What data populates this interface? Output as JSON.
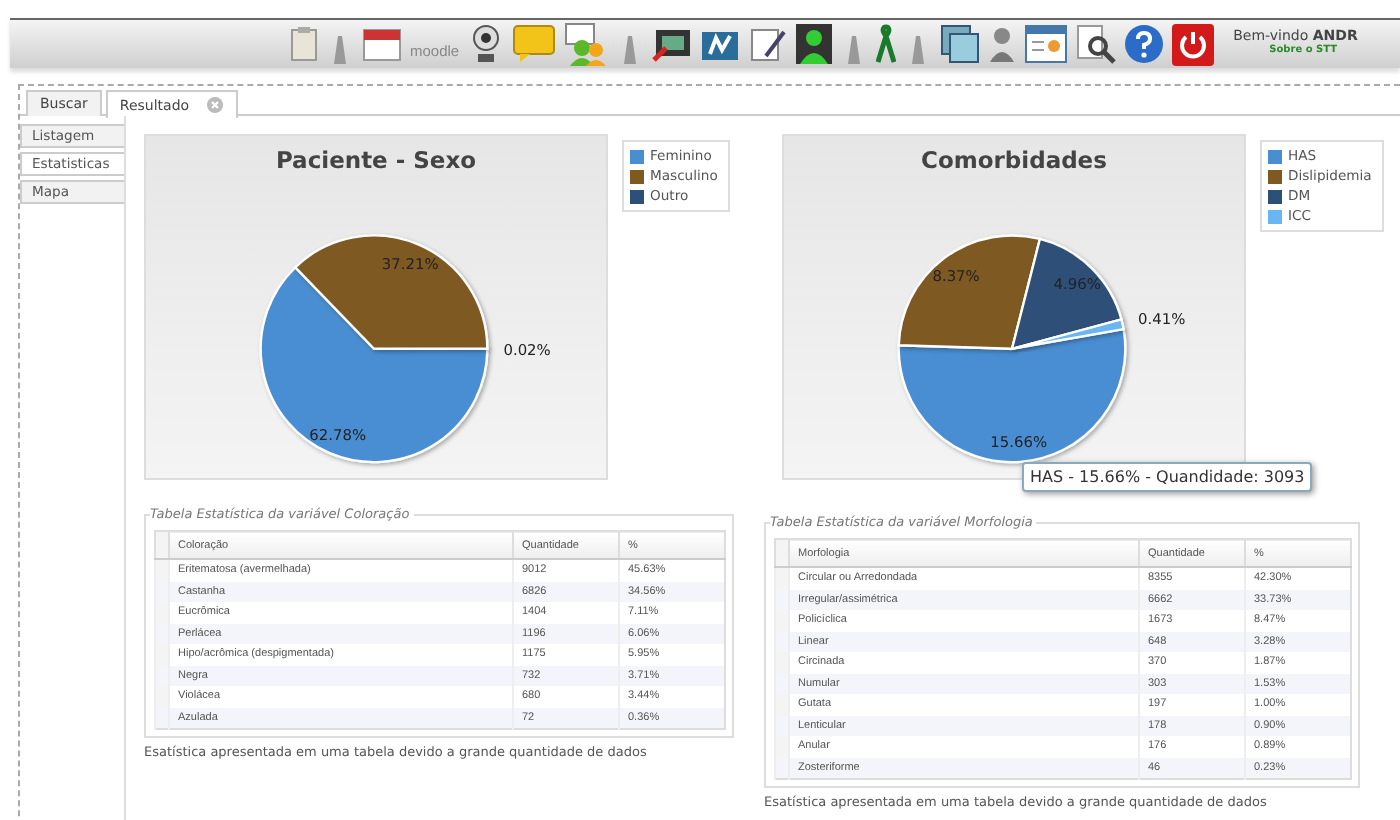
{
  "toolbar": {
    "logo_text": "moodle",
    "welcome": "Bem-vindo",
    "user": "ANDR",
    "about_link": "Sobre o STT"
  },
  "tabs": [
    {
      "label": "Buscar",
      "selected": false,
      "closable": false
    },
    {
      "label": "Resultado",
      "selected": true,
      "closable": true
    }
  ],
  "side_menu": [
    {
      "label": "Listagem",
      "selected": false
    },
    {
      "label": "Estatisticas",
      "selected": true
    },
    {
      "label": "Mapa",
      "selected": false
    }
  ],
  "charts": [
    {
      "chart_data": {
        "type": "pie",
        "title": "Paciente - Sexo",
        "categories": [
          "Feminino",
          "Masculino",
          "Outro"
        ],
        "values": [
          62.78,
          37.21,
          0.02
        ],
        "value_labels": [
          "62.78%",
          "37.21%",
          "0.02%"
        ],
        "colors": [
          "#4a8ed2",
          "#7e5a22",
          "#2d5078"
        ]
      }
    },
    {
      "chart_data": {
        "type": "pie",
        "title": "Comorbidades",
        "categories": [
          "HAS",
          "Dislipidemia",
          "DM",
          "ICC"
        ],
        "values": [
          15.66,
          8.37,
          4.96,
          0.41
        ],
        "value_labels": [
          "15.66%",
          "8.37%",
          "4.96%",
          "0.41%"
        ],
        "colors": [
          "#4a8ed2",
          "#7e5a22",
          "#2d5078",
          "#6ab6f2"
        ]
      },
      "tooltip": "HAS - 15.66% - Quandidade: 3093"
    }
  ],
  "tables": [
    {
      "legend": "Tabela Estatística da variável Coloração",
      "columns": [
        "Coloração",
        "Quantidade",
        "%"
      ],
      "rows": [
        [
          "Eritematosa (avermelhada)",
          "9012",
          "45.63%"
        ],
        [
          "Castanha",
          "6826",
          "34.56%"
        ],
        [
          "Eucrômica",
          "1404",
          "7.11%"
        ],
        [
          "Perlácea",
          "1196",
          "6.06%"
        ],
        [
          "Hipo/acrômica (despigmentada)",
          "1175",
          "5.95%"
        ],
        [
          "Negra",
          "732",
          "3.71%"
        ],
        [
          "Violácea",
          "680",
          "3.44%"
        ],
        [
          "Azulada",
          "72",
          "0.36%"
        ]
      ],
      "note": "Esatística apresentada em uma tabela devido a grande quantidade de dados"
    },
    {
      "legend": "Tabela Estatística da variável Morfologia",
      "columns": [
        "Morfologia",
        "Quantidade",
        "%"
      ],
      "rows": [
        [
          "Circular ou Arredondada",
          "8355",
          "42.30%"
        ],
        [
          "Irregular/assimétrica",
          "6662",
          "33.73%"
        ],
        [
          "Policíclica",
          "1673",
          "8.47%"
        ],
        [
          "Linear",
          "648",
          "3.28%"
        ],
        [
          "Circinada",
          "370",
          "1.87%"
        ],
        [
          "Numular",
          "303",
          "1.53%"
        ],
        [
          "Gutata",
          "197",
          "1.00%"
        ],
        [
          "Lenticular",
          "178",
          "0.90%"
        ],
        [
          "Anular",
          "176",
          "0.89%"
        ],
        [
          "Zosteriforme",
          "46",
          "0.23%"
        ]
      ],
      "note": "Esatística apresentada em uma tabela devido a grande quantidade de dados"
    }
  ]
}
